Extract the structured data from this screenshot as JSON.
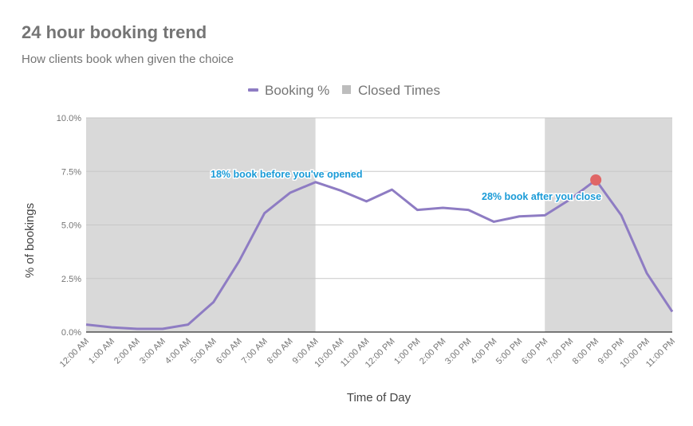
{
  "chart_data": {
    "type": "line",
    "title": "24 hour booking trend",
    "subtitle": "How clients book when given the choice",
    "xlabel": "Time of Day",
    "ylabel": "% of bookings",
    "ylim": [
      0,
      10
    ],
    "y_ticks": [
      0,
      2.5,
      5,
      7.5,
      10
    ],
    "y_tick_labels": [
      "0.0%",
      "2.5%",
      "5.0%",
      "7.5%",
      "10.0%"
    ],
    "grid": true,
    "legend_position": "top-center",
    "categories": [
      "12:00 AM",
      "1:00 AM",
      "2:00 AM",
      "3:00 AM",
      "4:00 AM",
      "5:00 AM",
      "6:00 AM",
      "7:00 AM",
      "8:00 AM",
      "9:00 AM",
      "10:00 AM",
      "11:00 AM",
      "12:00 PM",
      "1:00 PM",
      "2:00 PM",
      "3:00 PM",
      "4:00 PM",
      "5:00 PM",
      "6:00 PM",
      "7:00 PM",
      "8:00 PM",
      "9:00 PM",
      "10:00 PM",
      "11:00 PM"
    ],
    "series": [
      {
        "name": "Booking %",
        "color": "#8e7cc3",
        "values": [
          0.35,
          0.22,
          0.15,
          0.15,
          0.35,
          1.4,
          3.3,
          5.55,
          6.5,
          7.0,
          6.6,
          6.1,
          6.65,
          5.7,
          5.8,
          5.7,
          5.15,
          5.4,
          5.45,
          6.2,
          7.1,
          5.45,
          2.75,
          0.95
        ]
      }
    ],
    "closed_times": {
      "name": "Closed Times",
      "color": "#d9d9d9",
      "ranges": [
        [
          "12:00 AM",
          "9:00 AM"
        ],
        [
          "6:00 PM",
          "11:00 PM"
        ]
      ]
    },
    "highlight_point": {
      "category": "8:00 PM",
      "value": 7.1,
      "color": "#e06666"
    },
    "annotations": [
      {
        "text": "18% book before you've opened",
        "category": "9:00 AM",
        "value": 7.5,
        "color": "#1a9bd7"
      },
      {
        "text": "28% book after you close",
        "category": "6:00 PM",
        "value": 6.4,
        "color": "#1a9bd7"
      }
    ],
    "legend": [
      {
        "label": "Booking %",
        "color": "#8e7cc3",
        "shape": "line"
      },
      {
        "label": "Closed Times",
        "color": "#bdbdbd",
        "shape": "square"
      }
    ]
  }
}
